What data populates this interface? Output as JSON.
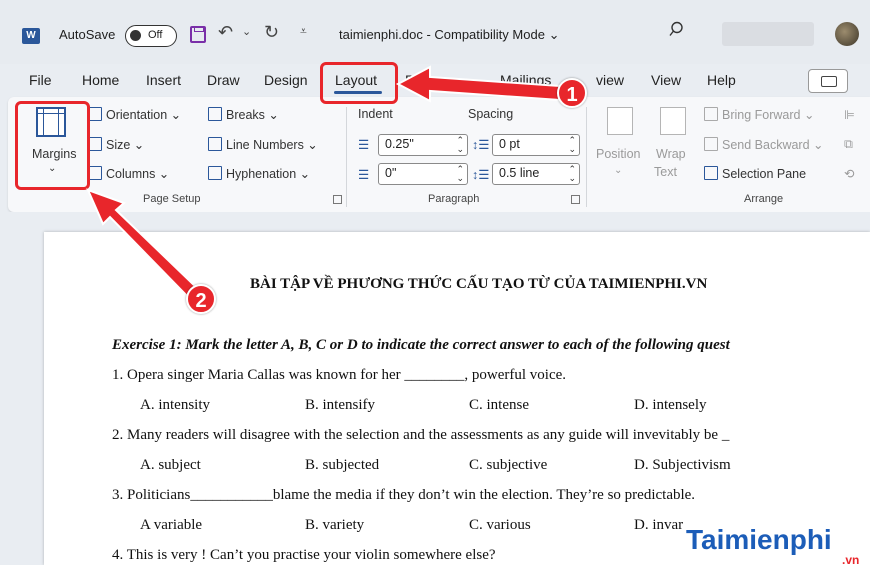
{
  "titlebar": {
    "autosave_label": "AutoSave",
    "autosave_state": "Off",
    "doc_title": "taimienphi.doc - Compatibility Mode",
    "doc_title_caret": "⌄"
  },
  "tabs": [
    "File",
    "Home",
    "Insert",
    "Draw",
    "Design",
    "Layout",
    "R",
    "Mailings",
    "view",
    "View",
    "Help"
  ],
  "ribbon": {
    "page_setup": {
      "margins_label": "Margins",
      "orientation": "Orientation",
      "size": "Size",
      "columns": "Columns",
      "breaks": "Breaks",
      "line_numbers": "Line Numbers",
      "hyphenation": "Hyphenation",
      "group_label": "Page Setup"
    },
    "paragraph": {
      "indent_label": "Indent",
      "spacing_label": "Spacing",
      "indent_left": "0.25\"",
      "indent_right": "0\"",
      "spacing_before": "0 pt",
      "spacing_after": "0.5 line",
      "group_label": "Paragraph"
    },
    "arrange": {
      "position": "Position",
      "wrap_text_1": "Wrap",
      "wrap_text_2": "Text",
      "bring_forward": "Bring Forward",
      "send_backward": "Send Backward",
      "selection_pane": "Selection Pane",
      "group_label": "Arrange"
    }
  },
  "document": {
    "heading": "BÀI TẬP VỀ PHƯƠNG THỨC CẤU TẠO TỪ CỦA TAIMIENPHI.VN",
    "exercise": "Exercise 1: Mark the letter A, B, C or D to indicate the correct answer to each of the following quest",
    "q1": "1.   Opera singer Maria Callas was known for her ________, powerful voice.",
    "q1_opts": [
      "A. intensity",
      "B. intensify",
      "C. intense",
      "D. intensely"
    ],
    "q2": "2. Many readers will disagree with the selection and the assessments as any guide will invevitably be _",
    "q2_opts": [
      "A. subject",
      "B. subjected",
      "C. subjective",
      "D. Subjectivism"
    ],
    "q3": "3. Politicians___________blame the media if they don’t win the election. They’re so predictable.",
    "q3_opts": [
      "A variable",
      "B. variety",
      "C. various",
      "D. invar"
    ],
    "q4": "4. This is very          ! Can’t you practise your violin somewhere else?"
  },
  "annotations": {
    "badge1": "1",
    "badge2": "2",
    "color": "#e8262b"
  },
  "watermark": {
    "text": "Taimienphi",
    "suffix": ".vn"
  },
  "colors": {
    "accent": "#2b579a",
    "annotation": "#e8262b"
  }
}
